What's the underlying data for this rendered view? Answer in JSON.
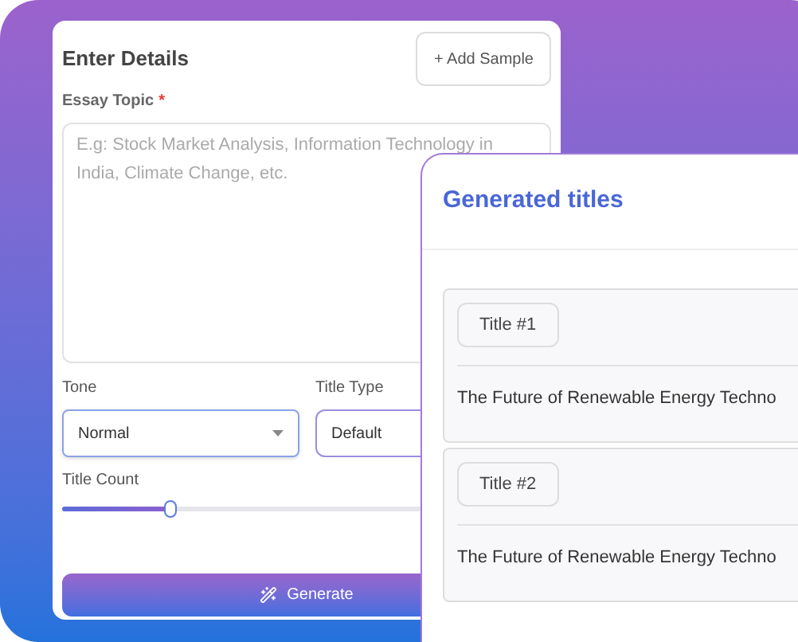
{
  "details_form": {
    "title": "Enter Details",
    "add_sample_button": "+ Add Sample",
    "essay_topic": {
      "label": "Essay Topic",
      "required_mark": "*",
      "placeholder": "E.g: Stock Market Analysis, Information Technology in India, Climate Change, etc."
    },
    "tone": {
      "label": "Tone",
      "value": "Normal"
    },
    "title_type": {
      "label": "Title Type",
      "value": "Default"
    },
    "title_count": {
      "label": "Title Count",
      "level": 0.22
    },
    "generate_button": "Generate"
  },
  "generated_titles": {
    "heading": "Generated titles",
    "items": [
      {
        "tag": "Title #1",
        "text": "The Future of Renewable Energy Techno"
      },
      {
        "tag": "Title #2",
        "text": "The Future of Renewable Energy Techno"
      }
    ]
  }
}
